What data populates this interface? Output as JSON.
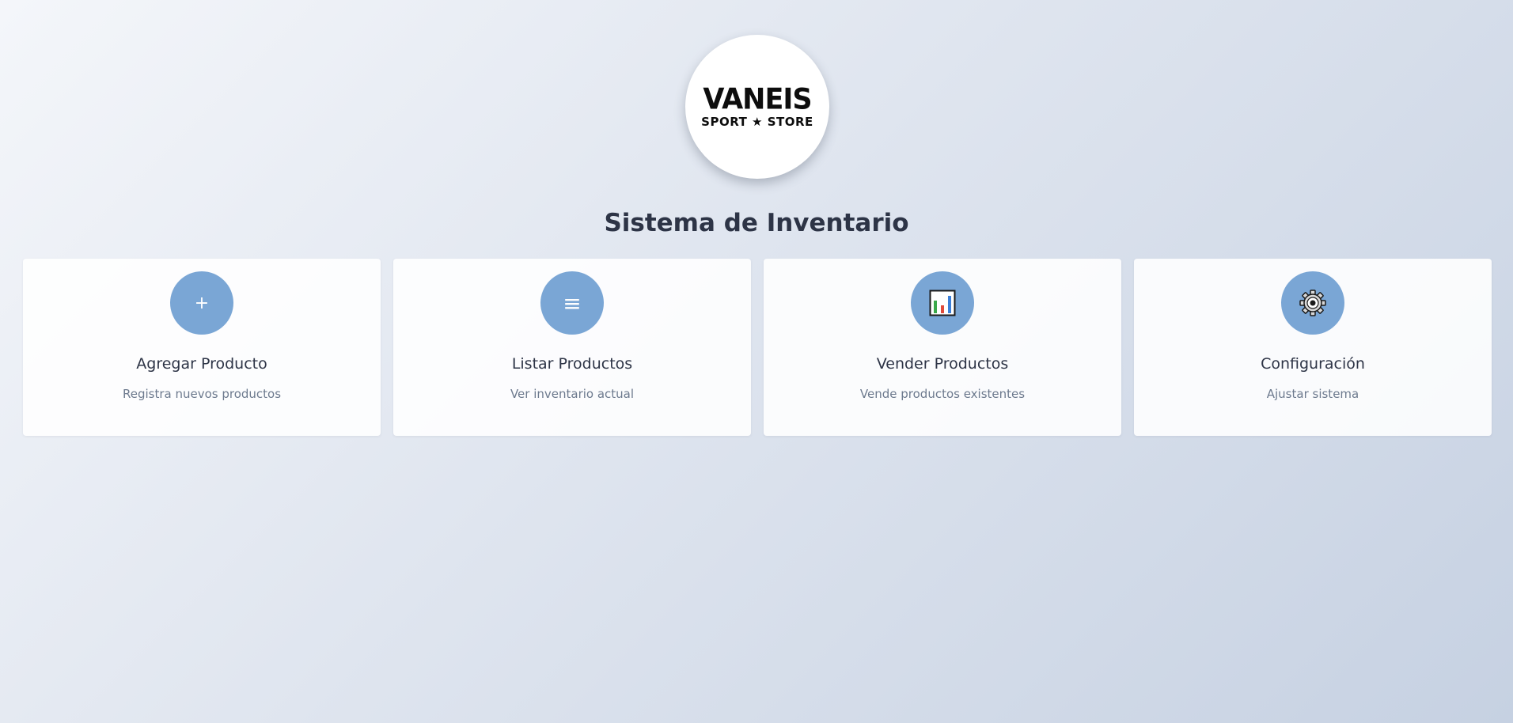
{
  "logo": {
    "brand": "VANEIS",
    "tagline": "SPORT ★ STORE"
  },
  "page": {
    "title": "Sistema de Inventario"
  },
  "colors": {
    "icon_bg": "#7aa6d5",
    "title_text": "#2d3446",
    "desc_text": "#6d7a8e"
  },
  "cards": [
    {
      "icon": "plus-icon",
      "glyph": "+",
      "title": "Agregar Producto",
      "description": "Registra nuevos productos"
    },
    {
      "icon": "list-icon",
      "glyph": "≡",
      "title": "Listar Productos",
      "description": "Ver inventario actual"
    },
    {
      "icon": "bar-chart-icon",
      "glyph": "",
      "title": "Vender Productos",
      "description": "Vende productos existentes"
    },
    {
      "icon": "gear-icon",
      "glyph": "",
      "title": "Configuración",
      "description": "Ajustar sistema"
    }
  ]
}
